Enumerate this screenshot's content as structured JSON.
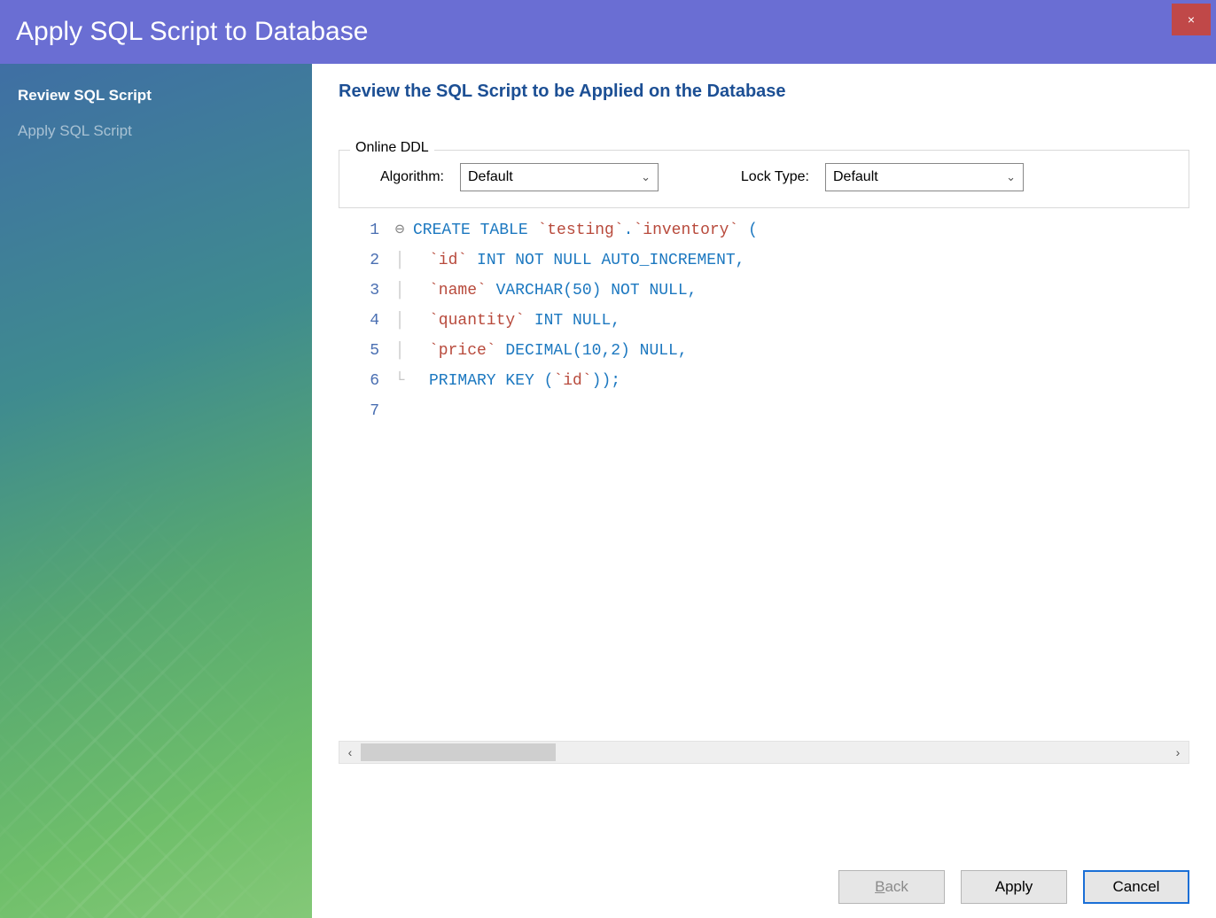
{
  "window": {
    "title": "Apply SQL Script to Database"
  },
  "sidebar": {
    "items": [
      {
        "label": "Review SQL Script",
        "active": true
      },
      {
        "label": "Apply SQL Script",
        "active": false
      }
    ]
  },
  "main": {
    "heading": "Review the SQL Script to be Applied on the Database",
    "fieldset_legend": "Online DDL",
    "algorithm_label": "Algorithm:",
    "algorithm_value": "Default",
    "locktype_label": "Lock Type:",
    "locktype_value": "Default"
  },
  "sql": {
    "lines": [
      {
        "n": 1,
        "fold": "start",
        "indent": 0,
        "tokens": [
          {
            "t": "kw",
            "v": "CREATE TABLE "
          },
          {
            "t": "str",
            "v": "`testing`"
          },
          {
            "t": "punc",
            "v": "."
          },
          {
            "t": "str",
            "v": "`inventory`"
          },
          {
            "t": "kw",
            "v": " ("
          }
        ]
      },
      {
        "n": 2,
        "fold": "mid",
        "indent": 1,
        "tokens": [
          {
            "t": "str",
            "v": "`id`"
          },
          {
            "t": "kw",
            "v": " INT NOT NULL AUTO_INCREMENT,"
          }
        ]
      },
      {
        "n": 3,
        "fold": "mid",
        "indent": 1,
        "tokens": [
          {
            "t": "str",
            "v": "`name`"
          },
          {
            "t": "kw",
            "v": " VARCHAR(50) NOT NULL,"
          }
        ]
      },
      {
        "n": 4,
        "fold": "mid",
        "indent": 1,
        "tokens": [
          {
            "t": "str",
            "v": "`quantity`"
          },
          {
            "t": "kw",
            "v": " INT NULL,"
          }
        ]
      },
      {
        "n": 5,
        "fold": "mid",
        "indent": 1,
        "tokens": [
          {
            "t": "str",
            "v": "`price`"
          },
          {
            "t": "kw",
            "v": " DECIMAL(10,2) NULL,"
          }
        ]
      },
      {
        "n": 6,
        "fold": "end",
        "indent": 1,
        "tokens": [
          {
            "t": "kw",
            "v": "PRIMARY KEY ("
          },
          {
            "t": "str",
            "v": "`id`"
          },
          {
            "t": "kw",
            "v": "));"
          }
        ]
      },
      {
        "n": 7,
        "fold": "none",
        "indent": 0,
        "tokens": []
      }
    ]
  },
  "buttons": {
    "back": "Back",
    "apply": "Apply",
    "cancel": "Cancel"
  },
  "icons": {
    "close": "×",
    "chevron_down": "⌄",
    "left": "‹",
    "right": "›",
    "fold_open": "⊖",
    "fold_mid": "│",
    "fold_end": "└"
  }
}
